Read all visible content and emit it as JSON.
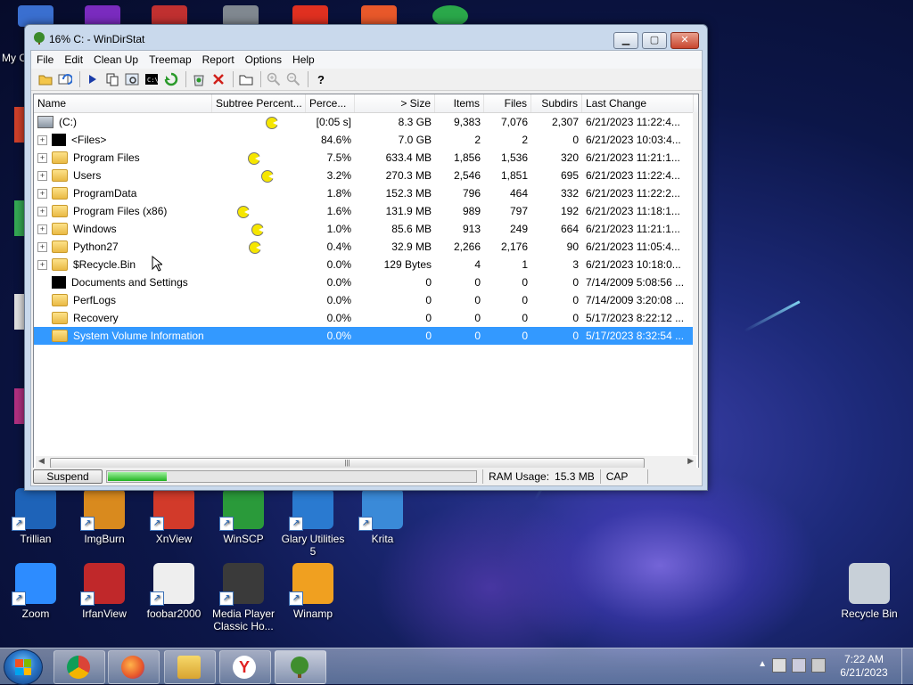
{
  "window": {
    "title": "16% C: - WinDirStat",
    "minimize": "▁",
    "maximize": "▢",
    "close": "✕"
  },
  "menu": [
    "File",
    "Edit",
    "Clean Up",
    "Treemap",
    "Report",
    "Options",
    "Help"
  ],
  "toolbar_icons": [
    "open-folder-icon",
    "refresh-icon",
    "play-icon",
    "copy-icon",
    "explorer-icon",
    "command-prompt-icon",
    "refresh-selected-icon",
    "recycle-icon",
    "delete-icon",
    "new-folder-icon",
    "zoom-in-icon",
    "zoom-out-icon",
    "help-icon"
  ],
  "columns": {
    "name": "Name",
    "subtree": "Subtree Percent...",
    "perc": "Perce...",
    "size": "> Size",
    "items": "Items",
    "files": "Files",
    "subdirs": "Subdirs",
    "last_change": "Last Change"
  },
  "rows": [
    {
      "name": "(C:)",
      "icon": "drive",
      "expand": "",
      "subtree": "pac",
      "pac_pos": 0.6,
      "perc": "[0:05 s]",
      "size": "8.3 GB",
      "items": "9,383",
      "files": "7,076",
      "subdirs": "2,307",
      "last": "6/21/2023  11:22:4..."
    },
    {
      "name": "<Files>",
      "icon": "black",
      "expand": "+",
      "subtree": "",
      "pac_pos": 0,
      "perc": "84.6%",
      "size": "7.0 GB",
      "items": "2",
      "files": "2",
      "subdirs": "0",
      "last": "6/21/2023  10:03:4..."
    },
    {
      "name": "Program Files",
      "icon": "folder",
      "expand": "+",
      "subtree": "pac",
      "pac_pos": 0.4,
      "perc": "7.5%",
      "size": "633.4 MB",
      "items": "1,856",
      "files": "1,536",
      "subdirs": "320",
      "last": "6/21/2023  11:21:1..."
    },
    {
      "name": "Users",
      "icon": "folder",
      "expand": "+",
      "subtree": "pac",
      "pac_pos": 0.55,
      "perc": "3.2%",
      "size": "270.3 MB",
      "items": "2,546",
      "files": "1,851",
      "subdirs": "695",
      "last": "6/21/2023  11:22:4..."
    },
    {
      "name": "ProgramData",
      "icon": "folder",
      "expand": "+",
      "subtree": "",
      "pac_pos": 0,
      "perc": "1.8%",
      "size": "152.3 MB",
      "items": "796",
      "files": "464",
      "subdirs": "332",
      "last": "6/21/2023  11:22:2..."
    },
    {
      "name": "Program Files (x86)",
      "icon": "folder",
      "expand": "+",
      "subtree": "pac",
      "pac_pos": 0.28,
      "perc": "1.6%",
      "size": "131.9 MB",
      "items": "989",
      "files": "797",
      "subdirs": "192",
      "last": "6/21/2023  11:18:1..."
    },
    {
      "name": "Windows",
      "icon": "folder",
      "expand": "+",
      "subtree": "pac",
      "pac_pos": 0.44,
      "perc": "1.0%",
      "size": "85.6 MB",
      "items": "913",
      "files": "249",
      "subdirs": "664",
      "last": "6/21/2023  11:21:1..."
    },
    {
      "name": "Python27",
      "icon": "folder",
      "expand": "+",
      "subtree": "pac",
      "pac_pos": 0.41,
      "perc": "0.4%",
      "size": "32.9 MB",
      "items": "2,266",
      "files": "2,176",
      "subdirs": "90",
      "last": "6/21/2023  11:05:4..."
    },
    {
      "name": "$Recycle.Bin",
      "icon": "folder",
      "expand": "+",
      "subtree": "",
      "pac_pos": 0,
      "perc": "0.0%",
      "size": "129 Bytes",
      "items": "4",
      "files": "1",
      "subdirs": "3",
      "last": "6/21/2023  10:18:0..."
    },
    {
      "name": "Documents and Settings",
      "icon": "black",
      "expand": "",
      "subtree": "",
      "pac_pos": 0,
      "perc": "0.0%",
      "size": "0",
      "items": "0",
      "files": "0",
      "subdirs": "0",
      "last": "7/14/2009  5:08:56 ..."
    },
    {
      "name": "PerfLogs",
      "icon": "folder",
      "expand": "",
      "subtree": "",
      "pac_pos": 0,
      "perc": "0.0%",
      "size": "0",
      "items": "0",
      "files": "0",
      "subdirs": "0",
      "last": "7/14/2009  3:20:08 ..."
    },
    {
      "name": "Recovery",
      "icon": "folder",
      "expand": "",
      "subtree": "",
      "pac_pos": 0,
      "perc": "0.0%",
      "size": "0",
      "items": "0",
      "files": "0",
      "subdirs": "0",
      "last": "5/17/2023  8:22:12 ..."
    },
    {
      "name": "System Volume Information",
      "icon": "folder",
      "expand": "",
      "subtree": "",
      "pac_pos": 0,
      "perc": "0.0%",
      "size": "0",
      "items": "0",
      "files": "0",
      "subdirs": "0",
      "last": "5/17/2023  8:32:54 ...",
      "selected": true
    }
  ],
  "status": {
    "suspend": "Suspend",
    "progress_fraction": 0.16,
    "ram_label": "RAM Usage:",
    "ram_value": "15.3 MB",
    "cap": "CAP"
  },
  "desktop_icons": [
    {
      "label": "Trillian",
      "color": "#1e63b8"
    },
    {
      "label": "ImgBurn",
      "color": "#d98a1e"
    },
    {
      "label": "XnView",
      "color": "#d23a2a"
    },
    {
      "label": "WinSCP",
      "color": "#2a9a3a"
    },
    {
      "label": "Glary Utilities 5",
      "color": "#2a7ad0"
    },
    {
      "label": "Krita",
      "color": "#3a8ad8"
    },
    {
      "label": "Zoom",
      "color": "#2d8cff"
    },
    {
      "label": "IrfanView",
      "color": "#c0282a"
    },
    {
      "label": "foobar2000",
      "color": "#eeeeee"
    },
    {
      "label": "Media Player Classic Ho...",
      "color": "#3a3a3a"
    },
    {
      "label": "Winamp",
      "color": "#f0a020"
    },
    {
      "label": "Recycle Bin",
      "color": "#c8d0d8"
    }
  ],
  "taskbar": {
    "time": "7:22 AM",
    "date": "6/21/2023",
    "apps": [
      "chrome-icon",
      "firefox-icon",
      "explorer-icon",
      "yandex-icon",
      "windirstat-icon"
    ]
  }
}
